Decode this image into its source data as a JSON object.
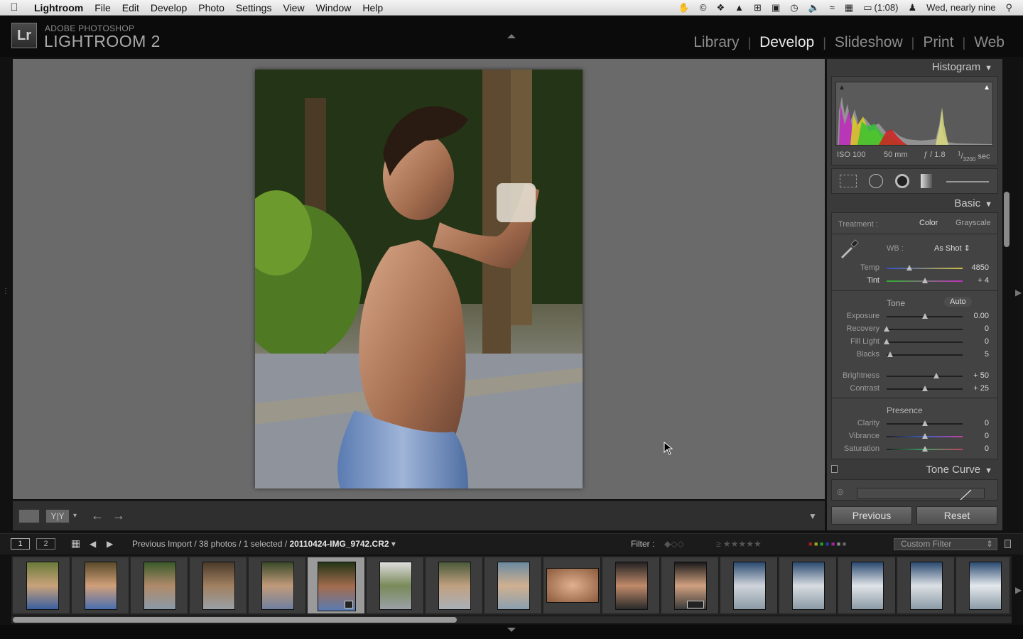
{
  "menubar": {
    "app": "Lightroom",
    "items": [
      "File",
      "Edit",
      "Develop",
      "Photo",
      "Settings",
      "View",
      "Window",
      "Help"
    ],
    "battery": "(1:08)",
    "clock": "Wed, nearly nine"
  },
  "brand": {
    "logo": "Lr",
    "line1": "ADOBE PHOTOSHOP",
    "line2": "LIGHTROOM 2"
  },
  "modules": [
    "Library",
    "Develop",
    "Slideshow",
    "Print",
    "Web"
  ],
  "active_module": "Develop",
  "histogram": {
    "title": "Histogram",
    "iso": "ISO 100",
    "focal": "50 mm",
    "aperture": "ƒ / 1.8",
    "shutter_num": "1",
    "shutter_den": "3200",
    "shutter_unit": "sec"
  },
  "basic": {
    "title": "Basic",
    "treatment_label": "Treatment :",
    "color": "Color",
    "grayscale": "Grayscale",
    "wb_label": "WB :",
    "wb_value": "As Shot",
    "temp_label": "Temp",
    "temp_value": "4850",
    "temp_pos": 0.3,
    "tint_label": "Tint",
    "tint_value": "+ 4",
    "tint_pos": 0.5,
    "tone_label": "Tone",
    "auto": "Auto",
    "exposure_label": "Exposure",
    "exposure_value": "0.00",
    "exposure_pos": 0.5,
    "recovery_label": "Recovery",
    "recovery_value": "0",
    "recovery_pos": 0.0,
    "filllight_label": "Fill Light",
    "filllight_value": "0",
    "filllight_pos": 0.0,
    "blacks_label": "Blacks",
    "blacks_value": "5",
    "blacks_pos": 0.05,
    "brightness_label": "Brightness",
    "brightness_value": "+ 50",
    "brightness_pos": 0.65,
    "contrast_label": "Contrast",
    "contrast_value": "+ 25",
    "contrast_pos": 0.5,
    "presence_label": "Presence",
    "clarity_label": "Clarity",
    "clarity_value": "0",
    "clarity_pos": 0.5,
    "vibrance_label": "Vibrance",
    "vibrance_value": "0",
    "vibrance_pos": 0.5,
    "saturation_label": "Saturation",
    "saturation_value": "0",
    "saturation_pos": 0.5
  },
  "tone_curve": {
    "title": "Tone Curve"
  },
  "panel_buttons": {
    "previous": "Previous",
    "reset": "Reset"
  },
  "filmbar": {
    "mon1": "1",
    "mon2": "2",
    "source": "Previous Import / 38 photos / 1 selected / ",
    "filename": "20110424-IMG_9742.CR2",
    "filter_label": "Filter :",
    "filter_value": "Custom Filter"
  },
  "colors": {
    "accent": "#eaeaea",
    "panel": "#3a3a3a",
    "viewer": "#6a6a6a"
  },
  "thumbnails": [
    "photo",
    "photo",
    "photo",
    "photo",
    "photo",
    "photo (selected)",
    "photo",
    "photo",
    "photo",
    "photo",
    "photo",
    "photo",
    "photo",
    "photo",
    "photo",
    "photo",
    "photo"
  ]
}
